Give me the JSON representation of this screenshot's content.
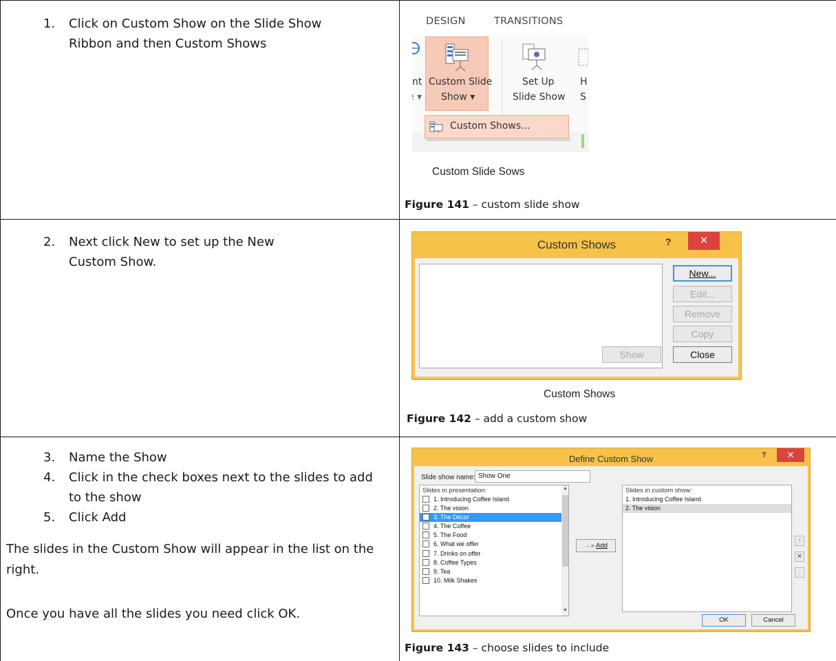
{
  "rows": [
    {
      "steps": [
        {
          "num": "1.",
          "text": "Click on Custom Show on the Slide Show Ribbon and then Custom Shows"
        }
      ],
      "shot_caption": "Custom Slide Sows",
      "figure": {
        "label": "Figure 141",
        "text": " – custom slide show"
      },
      "ribbon": {
        "tabs": [
          "DESIGN",
          "TRANSITIONS"
        ],
        "partial_left": [
          "nt",
          "e ▾"
        ],
        "custom_slide_show": [
          "Custom Slide",
          "Show ▾"
        ],
        "set_up_slide_show": [
          "Set Up",
          "Slide Show"
        ],
        "partial_right": [
          "H",
          "S"
        ],
        "dropdown_item": "Custom Shows..."
      }
    },
    {
      "steps": [
        {
          "num": "2.",
          "text": "Next click New to set up the New Custom Show."
        }
      ],
      "shot_caption": "Custom Shows",
      "figure": {
        "label": "Figure 142",
        "text": " – add a custom show"
      },
      "dialog": {
        "title": "Custom Shows",
        "help": "?",
        "close": "✕",
        "buttons": {
          "new": "New...",
          "edit": "Edit...",
          "remove": "Remove",
          "copy": "Copy",
          "show": "Show",
          "close": "Close"
        }
      }
    },
    {
      "steps": [
        {
          "num": "3.",
          "text": "Name the Show"
        },
        {
          "num": "4.",
          "text": "Click in the check boxes next to the slides to add to the show"
        },
        {
          "num": "5.",
          "text": "Click Add"
        }
      ],
      "paragraphs": [
        "The slides in the Custom Show will appear in the list on the right.",
        "Once you have all the slides you need click OK."
      ],
      "figure": {
        "label": "Figure 143",
        "text": " – choose slides to include"
      },
      "define_dialog": {
        "title": "Define Custom Show",
        "help": "?",
        "close": "✕",
        "name_label": "Slide show name:",
        "name_value": "Show One",
        "left_header": "Slides in presentation:",
        "right_header": "Slides in custom show:",
        "slides": [
          {
            "label": "1. Introducing Coffee Island",
            "checked": false,
            "selected": false
          },
          {
            "label": "2. The vision",
            "checked": false,
            "selected": false
          },
          {
            "label": "3. The Décor",
            "checked": true,
            "selected": true
          },
          {
            "label": "4. The Coffee",
            "checked": false,
            "selected": false
          },
          {
            "label": "5. The Food",
            "checked": false,
            "selected": false
          },
          {
            "label": "6. What we offer",
            "checked": false,
            "selected": false
          },
          {
            "label": "7. Drinks on offer",
            "checked": false,
            "selected": false
          },
          {
            "label": "8. Coffee Types",
            "checked": false,
            "selected": false
          },
          {
            "label": "9. Tea",
            "checked": false,
            "selected": false
          },
          {
            "label": "10. Milk Shakes",
            "checked": false,
            "selected": false
          }
        ],
        "custom_slides": [
          {
            "label": "1. Introducing Coffee Island",
            "selected": false
          },
          {
            "label": "2. The vision",
            "selected": true
          }
        ],
        "add_label": "Add",
        "ok_label": "OK",
        "cancel_label": "Cancel",
        "side_icons": [
          "↑",
          "✕",
          "↓"
        ]
      }
    }
  ]
}
